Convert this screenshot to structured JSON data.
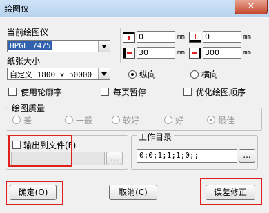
{
  "window": {
    "title": "绘图仪",
    "close_glyph": "✕"
  },
  "plotter": {
    "label": "当前绘图仪",
    "selected": "HPGL 7475"
  },
  "paper": {
    "label": "纸张大小",
    "selected": "自定义 1800 x 50000"
  },
  "margins": {
    "unit": "mm",
    "top": "0",
    "bottom": "0",
    "left": "30",
    "right": "300"
  },
  "orientation": {
    "portrait": "纵向",
    "landscape": "横向",
    "selected": "portrait"
  },
  "options": {
    "outline_font": "使用轮廓字",
    "page_pause": "每页暂停",
    "optimize_order": "优化绘图顺序"
  },
  "quality": {
    "title": "绘图质量",
    "levels": [
      "差",
      "一般",
      "较好",
      "好",
      "最佳"
    ],
    "selected": "最佳"
  },
  "output": {
    "checkbox_label": "输出到文件(F)",
    "browse": "..."
  },
  "workdir": {
    "title": "工作目录",
    "value": "0;0;1;1;1;0;;",
    "browse": "..."
  },
  "buttons": {
    "ok": "确定(O)",
    "cancel": "取消(C)",
    "calibrate": "误差修正"
  },
  "highlight_color": "#e0201c"
}
